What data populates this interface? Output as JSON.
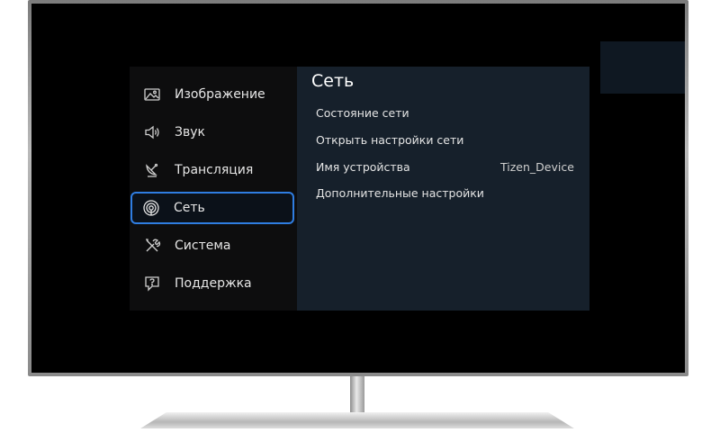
{
  "sidebar": {
    "items": [
      {
        "label": "Изображение",
        "icon": "picture-icon"
      },
      {
        "label": "Звук",
        "icon": "speaker-icon"
      },
      {
        "label": "Трансляция",
        "icon": "satellite-dish-icon"
      },
      {
        "label": "Сеть",
        "icon": "network-icon",
        "selected": true
      },
      {
        "label": "Система",
        "icon": "tools-icon"
      },
      {
        "label": "Поддержка",
        "icon": "support-icon"
      }
    ]
  },
  "main": {
    "title": "Сеть",
    "rows": [
      {
        "label": "Состояние сети"
      },
      {
        "label": "Открыть настройки сети"
      },
      {
        "label": "Имя устройства",
        "value": "Tizen_Device"
      },
      {
        "label": "Дополнительные настройки"
      }
    ]
  },
  "colors": {
    "selection_border": "#2f7de1",
    "main_panel_bg": "#16202b",
    "side_panel_bg": "#0d0d0e"
  }
}
